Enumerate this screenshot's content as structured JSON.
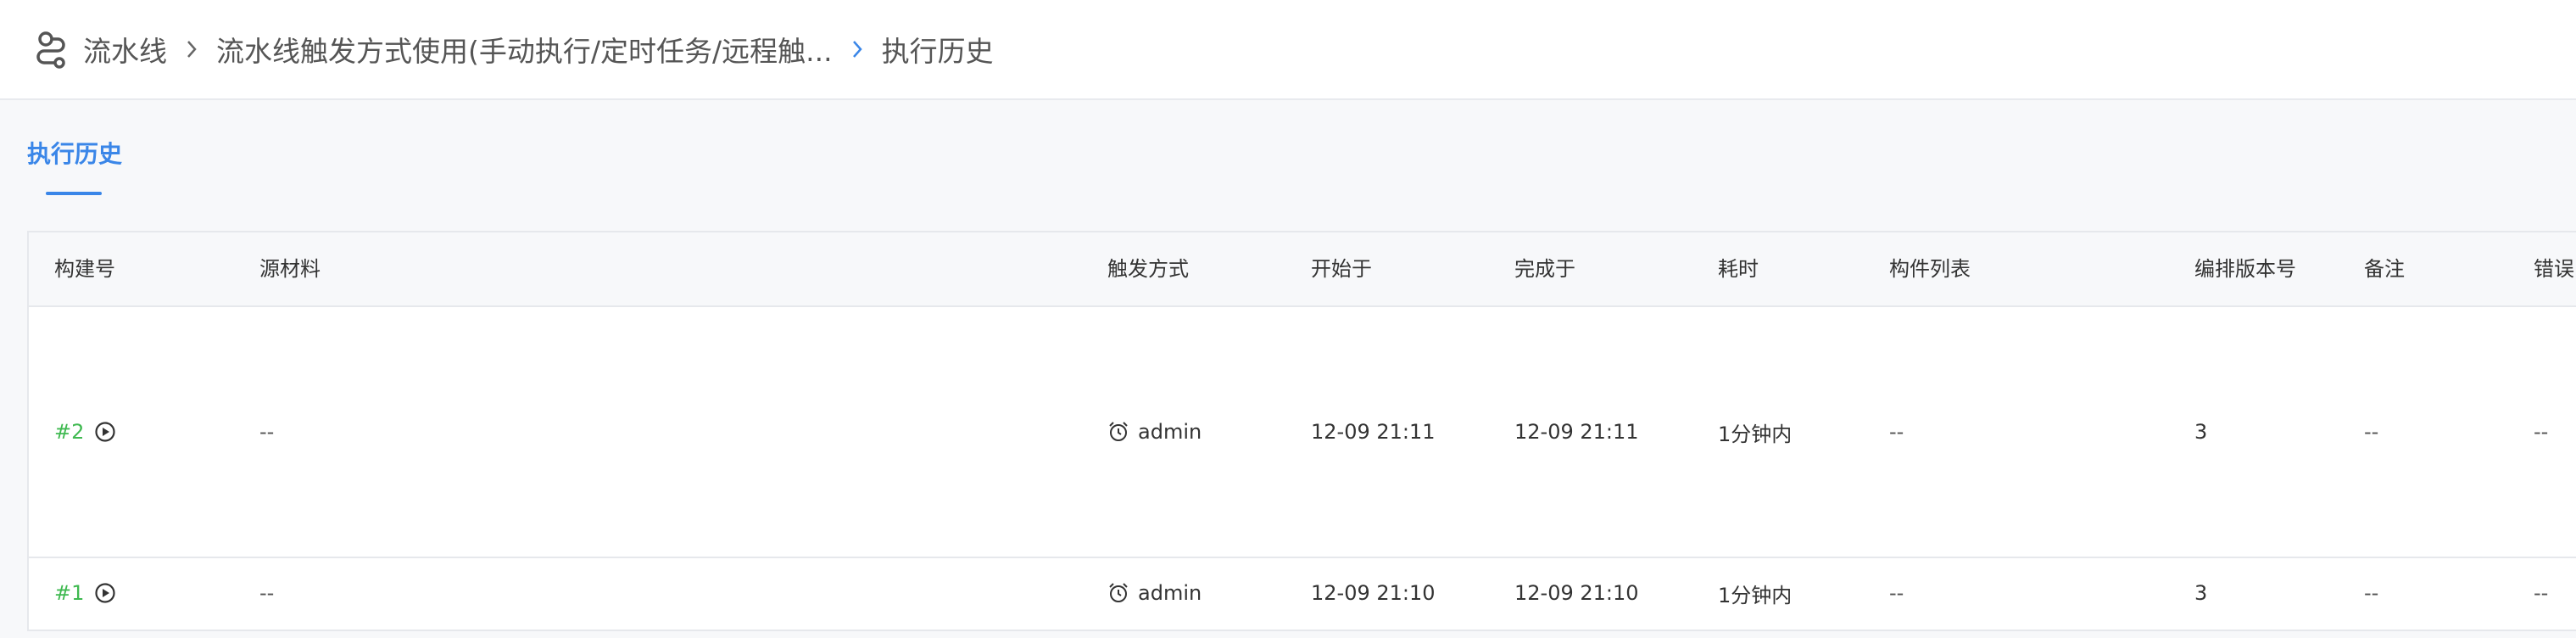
{
  "breadcrumb": {
    "items": [
      "流水线",
      "流水线触发方式使用(手动执行/定时任务/远程触...",
      "执行历史"
    ]
  },
  "tabs": [
    {
      "label": "执行历史",
      "active": true
    }
  ],
  "table": {
    "columns": [
      "构建号",
      "源材料",
      "触发方式",
      "开始于",
      "完成于",
      "耗时",
      "构件列表",
      "编排版本号",
      "备注",
      "错误"
    ],
    "rows": [
      {
        "build": "#2",
        "source": "--",
        "trigger": "admin",
        "start": "12-09 21:11",
        "finish": "12-09 21:11",
        "duration": "1分钟内",
        "artifacts": "--",
        "version": "3",
        "note": "--",
        "error": "--"
      },
      {
        "build": "#1",
        "source": "--",
        "trigger": "admin",
        "start": "12-09 21:10",
        "finish": "12-09 21:10",
        "duration": "1分钟内",
        "artifacts": "--",
        "version": "3",
        "note": "--",
        "error": "--"
      }
    ]
  },
  "colors": {
    "accent": "#3a86e8",
    "success": "#3fb950"
  }
}
